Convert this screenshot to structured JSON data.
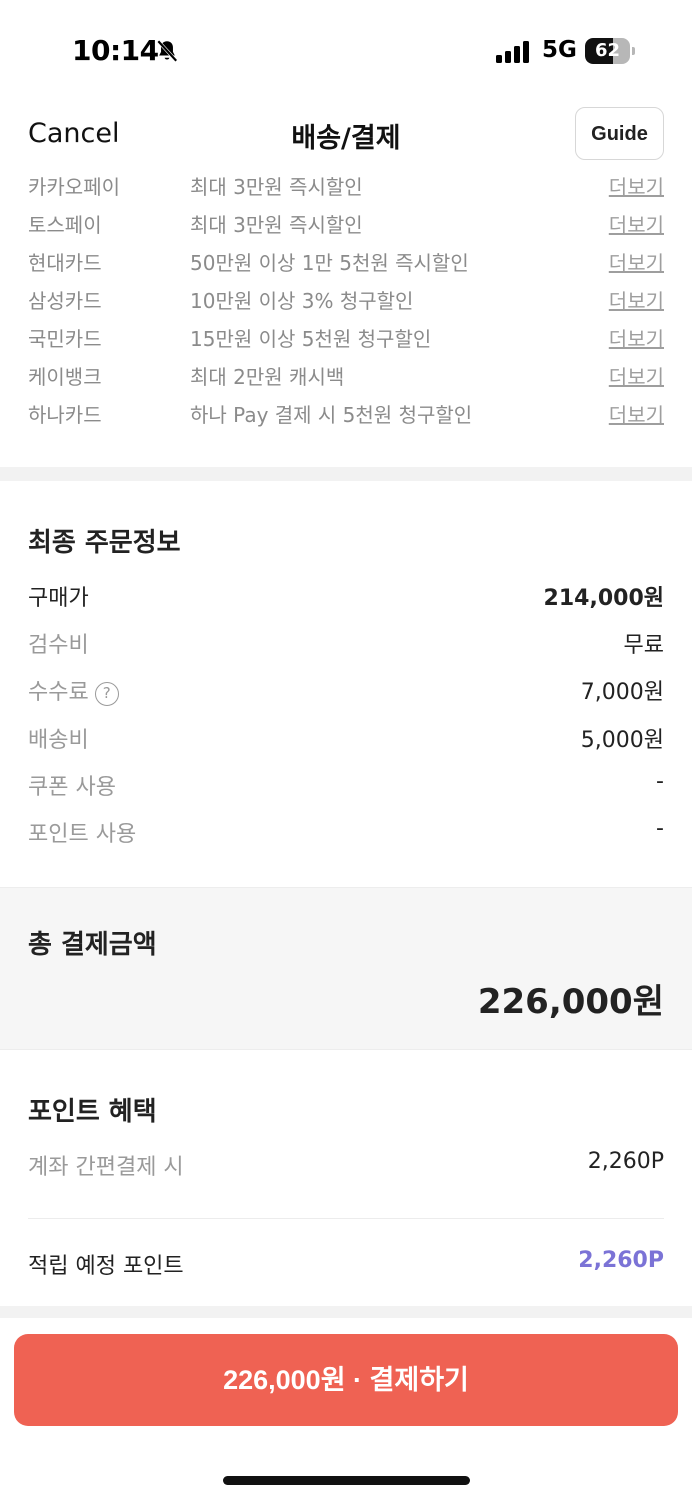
{
  "status_bar": {
    "time": "10:14",
    "network": "5G",
    "battery": "62",
    "battery_level": 0.62,
    "icons": [
      "bell-slash-icon",
      "signal-bars-icon",
      "battery-icon"
    ]
  },
  "nav": {
    "cancel_label": "Cancel",
    "title": "배송/결제",
    "guide_label": "Guide"
  },
  "benefits": [
    {
      "name": "카카오페이",
      "desc": "최대 3만원 즉시할인",
      "more": "더보기"
    },
    {
      "name": "토스페이",
      "desc": "최대 3만원 즉시할인",
      "more": "더보기"
    },
    {
      "name": "현대카드",
      "desc": "50만원 이상 1만 5천원 즉시할인",
      "more": "더보기"
    },
    {
      "name": "삼성카드",
      "desc": "10만원 이상 3% 청구할인",
      "more": "더보기"
    },
    {
      "name": "국민카드",
      "desc": "15만원 이상 5천원 청구할인",
      "more": "더보기"
    },
    {
      "name": "케이뱅크",
      "desc": "최대 2만원 캐시백",
      "more": "더보기"
    },
    {
      "name": "하나카드",
      "desc": "하나 Pay 결제 시 5천원 청구할인",
      "more": "더보기"
    }
  ],
  "order": {
    "title": "최종 주문정보",
    "rows": [
      {
        "label": "구매가",
        "value": "214,000원"
      },
      {
        "label": "검수비",
        "value": "무료"
      },
      {
        "label": "수수료",
        "value": "7,000원",
        "help_icon": "question-circle-icon"
      },
      {
        "label": "배송비",
        "value": "5,000원"
      },
      {
        "label": "쿠폰 사용",
        "value": "-"
      },
      {
        "label": "포인트 사용",
        "value": "-"
      }
    ]
  },
  "total": {
    "label": "총 결제금액",
    "amount": "226,000원"
  },
  "points": {
    "title": "포인트 혜택",
    "account_label": "계좌 간편결제 시",
    "account_value": "2,260P",
    "expected_label": "적립 예정 포인트",
    "expected_value": "2,260P",
    "accent_color": "#7b73d6"
  },
  "pay_button": {
    "label": "226,000원 · 결제하기",
    "color": "#ef6253"
  }
}
